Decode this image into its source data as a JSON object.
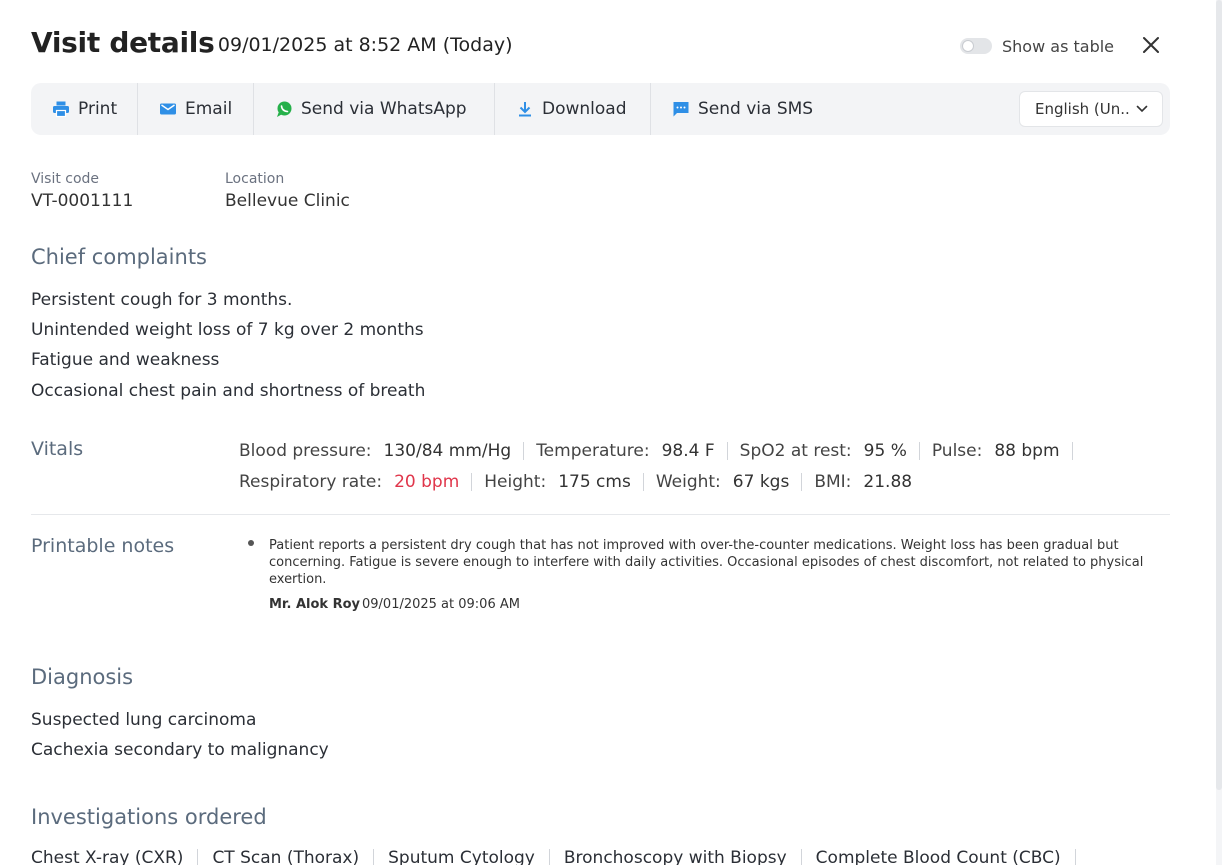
{
  "header": {
    "title": "Visit details",
    "subtitle": "- 09/01/2025 at 8:52 AM (Today)",
    "toggle_label": "Show as table"
  },
  "toolbar": {
    "print": "Print",
    "email": "Email",
    "whatsapp": "Send via WhatsApp",
    "download": "Download",
    "sms": "Send via SMS",
    "language": "English (Un..."
  },
  "meta": {
    "visit_code_label": "Visit code",
    "visit_code": "VT-0001111",
    "location_label": "Location",
    "location": "Bellevue Clinic"
  },
  "chief_complaints": {
    "title": "Chief complaints",
    "items": [
      "Persistent cough for 3 months.",
      "Unintended weight loss of 7 kg over 2 months",
      "Fatigue and weakness",
      "Occasional chest pain and shortness of breath"
    ]
  },
  "vitals": {
    "title": "Vitals",
    "items": [
      {
        "label": "Blood pressure:",
        "value": "130/84 mm/Hg"
      },
      {
        "label": "Temperature:",
        "value": "98.4 F"
      },
      {
        "label": "SpO2 at rest:",
        "value": "95 %"
      },
      {
        "label": "Pulse:",
        "value": "88 bpm"
      },
      {
        "label": "Respiratory rate:",
        "value": "20 bpm"
      },
      {
        "label": "Height:",
        "value": "175 cms"
      },
      {
        "label": "Weight:",
        "value": "67 kgs"
      },
      {
        "label": "BMI:",
        "value": "21.88"
      }
    ],
    "alert_color": "#e0364b"
  },
  "notes": {
    "title": "Printable notes",
    "text": "Patient reports a persistent dry cough that has not improved with over-the-counter medications. Weight loss has been gradual but concerning. Fatigue is severe enough to interfere with daily activities. Occasional episodes of chest discomfort, not related to physical exertion.",
    "author": "Mr. Alok Roy",
    "timestamp": "09/01/2025 at 09:06 AM"
  },
  "diagnosis": {
    "title": "Diagnosis",
    "items": [
      "Suspected lung carcinoma",
      "Cachexia secondary to malignancy"
    ]
  },
  "investigations": {
    "title": "Investigations ordered",
    "items": [
      "Chest X-ray (CXR)",
      "CT Scan (Thorax)",
      "Sputum Cytology",
      "Bronchoscopy with Biopsy",
      "Complete Blood Count (CBC)"
    ]
  },
  "colors": {
    "section_title": "#5b6b7d",
    "toolbar_bg": "#f3f4f6",
    "icon_blue": "#2f8fe6",
    "whatsapp_green": "#25b04a"
  },
  "icons": {
    "print": "printer-icon",
    "email": "envelope-icon",
    "whatsapp": "whatsapp-icon",
    "download": "download-icon",
    "sms": "message-icon",
    "close": "close-icon",
    "language": "chevron-down-icon"
  }
}
